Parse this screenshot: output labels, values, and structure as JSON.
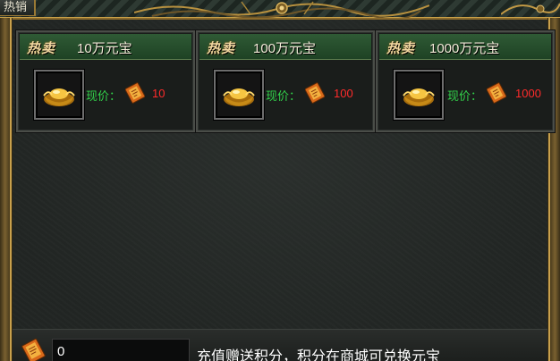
{
  "window": {
    "tab_label": "热销"
  },
  "products": [
    {
      "hot_tag": "热卖",
      "title": "10万元宝",
      "price_label": "现价：",
      "price": "10",
      "item_icon": "gold-ingot-icon"
    },
    {
      "hot_tag": "热卖",
      "title": "100万元宝",
      "price_label": "现价：",
      "price": "100",
      "item_icon": "gold-ingot-icon"
    },
    {
      "hot_tag": "热卖",
      "title": "1000万元宝",
      "price_label": "现价：",
      "price": "1000",
      "item_icon": "gold-ingot-icon"
    }
  ],
  "currency_icon": "voucher-ticket-icon",
  "footer": {
    "balance": "0",
    "notice": "充值赠送积分，积分在商城可兑换元宝"
  },
  "colors": {
    "price_label": "#32d24a",
    "price_value": "#ff2b2b",
    "card_header": "#2f5a35",
    "frame_gold": "#c8a04c"
  }
}
